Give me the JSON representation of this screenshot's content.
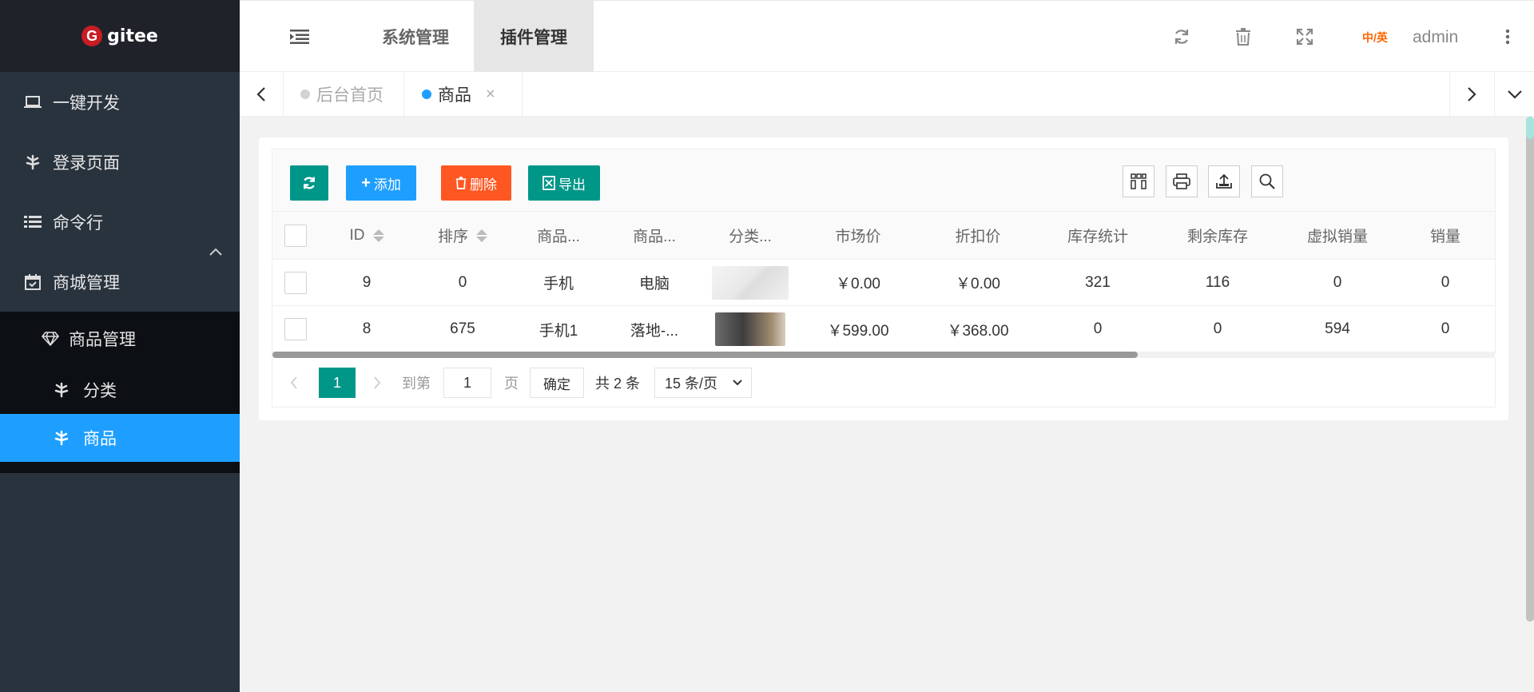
{
  "sidebar": {
    "logo_text": "gitee",
    "logo_mark": "G",
    "items": [
      {
        "label": "一键开发",
        "icon": "laptop-icon"
      },
      {
        "label": "登录页面",
        "icon": "leaf-icon"
      },
      {
        "label": "命令行",
        "icon": "list-icon"
      },
      {
        "label": "商城管理",
        "icon": "calendar-icon"
      }
    ],
    "submenu": {
      "label": "商品管理",
      "icon": "diamond-icon",
      "children": [
        {
          "label": "分类",
          "icon": "leaf-icon"
        },
        {
          "label": "商品",
          "icon": "leaf-icon",
          "active": true
        }
      ]
    }
  },
  "header": {
    "tabs": [
      "系统管理",
      "插件管理"
    ],
    "active_tab": "插件管理",
    "lang_label": "中/英",
    "user": "admin"
  },
  "page_tabs": [
    {
      "label": "后台首页",
      "active": false
    },
    {
      "label": "商品",
      "active": true
    }
  ],
  "toolbar": {
    "add_label": "添加",
    "delete_label": "删除",
    "export_label": "导出"
  },
  "table": {
    "headers": [
      "ID",
      "排序",
      "商品...",
      "商品...",
      "分类...",
      "市场价",
      "折扣价",
      "库存统计",
      "剩余库存",
      "虚拟销量",
      "销量"
    ],
    "rows": [
      {
        "id": "9",
        "sort": "0",
        "name": "手机",
        "cat": "电脑",
        "market": "￥0.00",
        "discount": "￥0.00",
        "stock_total": "321",
        "stock_left": "116",
        "virtual_sales": "0",
        "sales": "0"
      },
      {
        "id": "8",
        "sort": "675",
        "name": "手机1",
        "cat": "落地-...",
        "market": "￥599.00",
        "discount": "￥368.00",
        "stock_total": "0",
        "stock_left": "0",
        "virtual_sales": "594",
        "sales": "0"
      }
    ]
  },
  "pagination": {
    "current": "1",
    "goto_label": "到第",
    "goto_value": "1",
    "page_label": "页",
    "confirm_label": "确定",
    "total_label": "共 2 条",
    "per_page": "15 条/页"
  },
  "colors": {
    "primary_blue": "#1e9fff",
    "teal": "#009688",
    "danger": "#ff5722",
    "sidebar_bg": "#28333e"
  }
}
